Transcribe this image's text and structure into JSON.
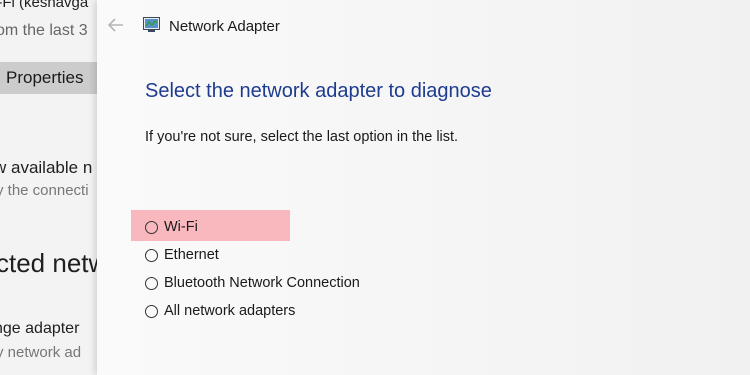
{
  "background_window": {
    "line1": "i-Fi (keshavga",
    "line2": "om the last 3",
    "properties_button": "Properties",
    "line3": "w available n",
    "line4": "y the connecti",
    "line5": "cted netwo",
    "line6": "nge adapter",
    "line7": "y network ad"
  },
  "dialog": {
    "title": "Network Adapter",
    "back_icon": "back-arrow-icon",
    "app_icon": "network-adapter-icon",
    "heading": "Select the network adapter to diagnose",
    "subtext": "If you're not sure, select the last option in the list.",
    "options": [
      {
        "label": "Wi-Fi",
        "highlighted": true
      },
      {
        "label": "Ethernet"
      },
      {
        "label": "Bluetooth Network Connection"
      },
      {
        "label": "All network adapters"
      }
    ],
    "colors": {
      "heading": "#1e3c8f",
      "highlight": "#f9b8bd"
    }
  }
}
